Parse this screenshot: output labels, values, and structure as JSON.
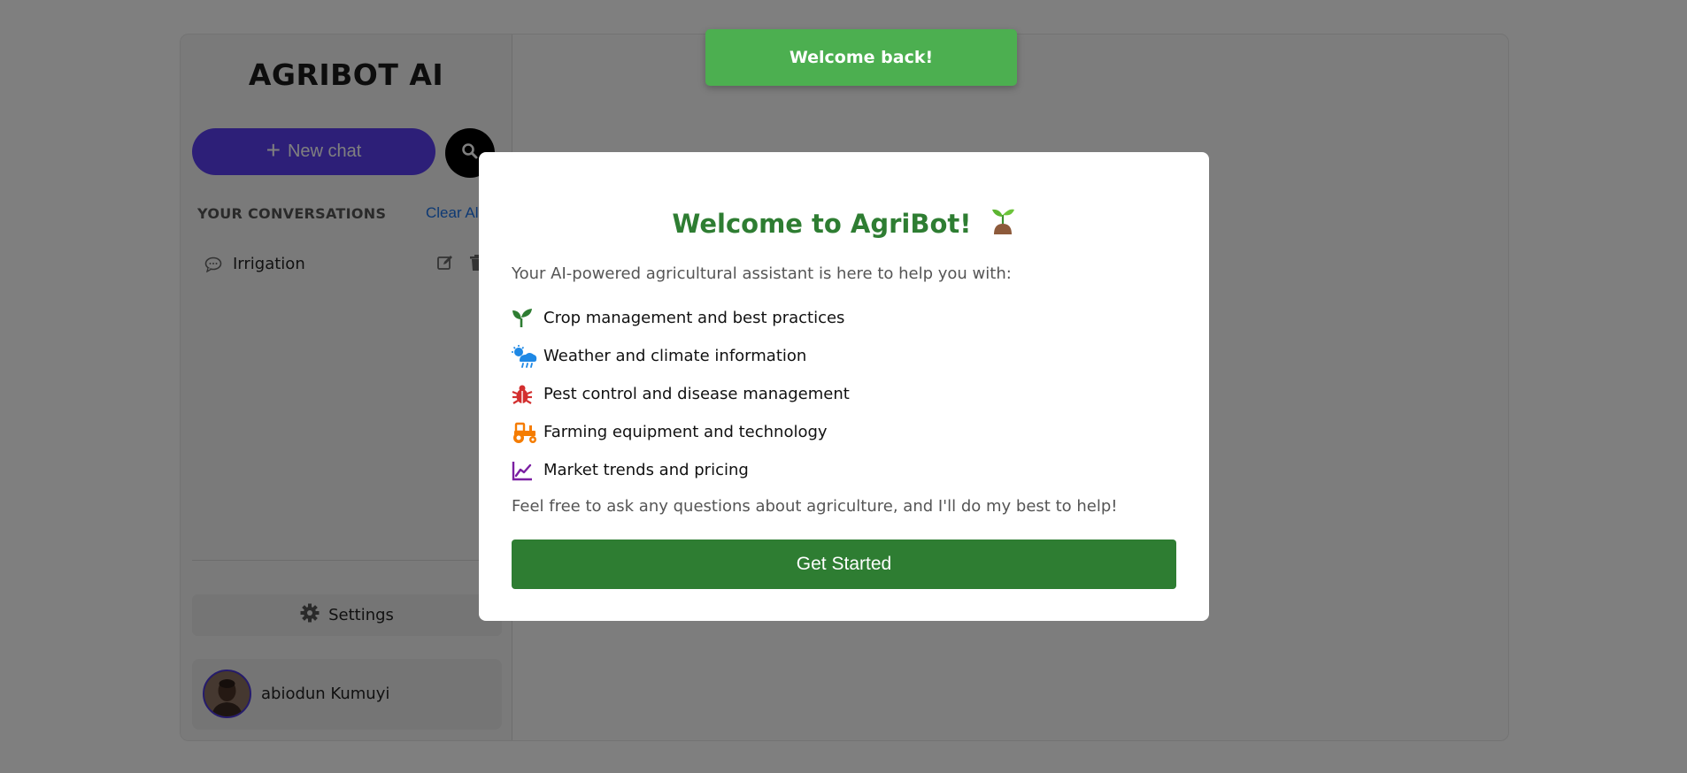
{
  "app": {
    "title": "AGRIBOT AI"
  },
  "sidebar": {
    "new_chat_label": "New chat",
    "conversations_header": "YOUR CONVERSATIONS",
    "clear_all_label": "Clear All",
    "conversations": [
      {
        "label": "Irrigation",
        "icon": "chat-bubble-icon"
      }
    ],
    "settings_label": "Settings",
    "user_name": "abiodun Kumuyi"
  },
  "toast": {
    "message": "Welcome back!"
  },
  "modal": {
    "title": "Welcome to AgriBot!",
    "intro": "Your AI-powered agricultural assistant is here to help you with:",
    "features": [
      {
        "label": "Crop management and best practices",
        "icon": "seedling-icon",
        "color": "#2e7d32"
      },
      {
        "label": "Weather and climate information",
        "icon": "cloud-sun-rain-icon",
        "color": "#1e88e5"
      },
      {
        "label": "Pest control and disease management",
        "icon": "bug-icon",
        "color": "#d32f2f"
      },
      {
        "label": "Farming equipment and technology",
        "icon": "tractor-icon",
        "color": "#f57c00"
      },
      {
        "label": "Market trends and pricing",
        "icon": "chart-line-icon",
        "color": "#7b1fa2"
      }
    ],
    "outro": "Feel free to ask any questions about agriculture, and I'll do my best to help!",
    "button_label": "Get Started"
  },
  "colors": {
    "brand_green": "#2e7d32",
    "toast_green": "#4caf50",
    "accent_purple": "#5a3ff0",
    "link_blue": "#1a73e8"
  }
}
